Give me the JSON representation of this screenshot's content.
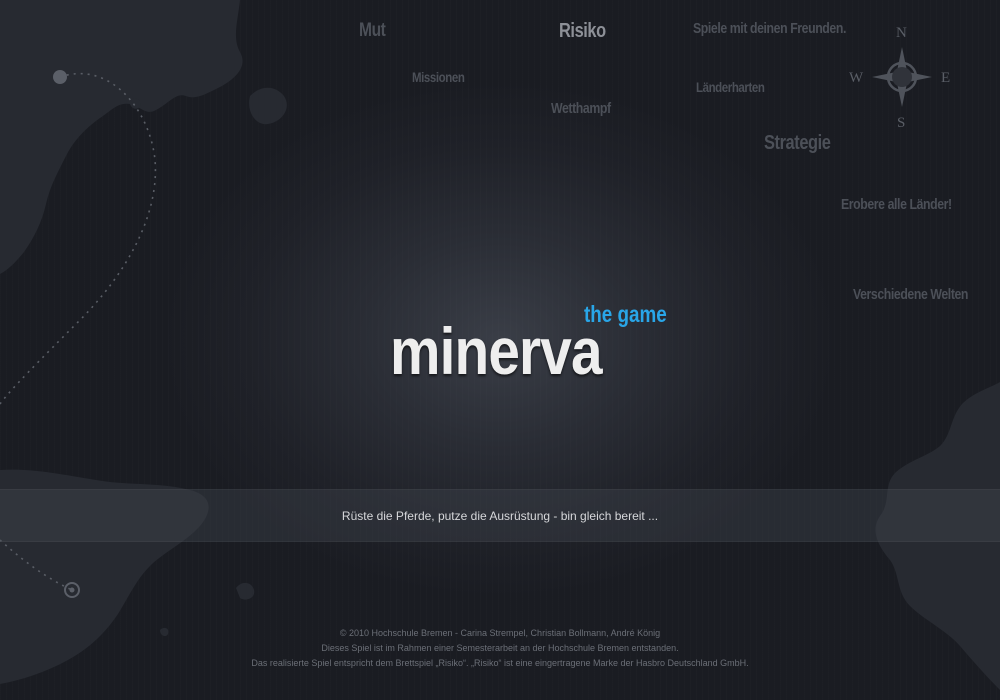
{
  "background_words": [
    {
      "text": "Mut"
    },
    {
      "text": "Risiko"
    },
    {
      "text": "Spiele mit deinen Freunden."
    },
    {
      "text": "Missionen"
    },
    {
      "text": "Wetthampf"
    },
    {
      "text": "Länderharten"
    },
    {
      "text": "Strategie"
    },
    {
      "text": "Erobere alle Länder!"
    },
    {
      "text": "Verschiedene Welten"
    }
  ],
  "compass": {
    "north": "N",
    "south": "S",
    "west": "W",
    "east": "E"
  },
  "logo": {
    "name": "minerva",
    "tagline": "the game"
  },
  "status": {
    "message": "Rüste die Pferde, putze die Ausrüstung - bin gleich bereit ..."
  },
  "footer": {
    "line1": "© 2010 Hochschule Bremen - Carina Strempel, Christian Bollmann, André König",
    "line2": "Dieses Spiel ist im Rahmen einer Semesterarbeit an der Hochschule Bremen entstanden.",
    "line3": "Das realisierte Spiel entspricht dem Brettspiel „Risiko“. „Risiko“ ist eine eingertragene Marke der Hasbro Deutschland GmbH."
  },
  "colors": {
    "background": "#1b1d23",
    "accent": "#29a6e8",
    "logo": "#eeeeee",
    "muted_text": "#4c5058"
  }
}
